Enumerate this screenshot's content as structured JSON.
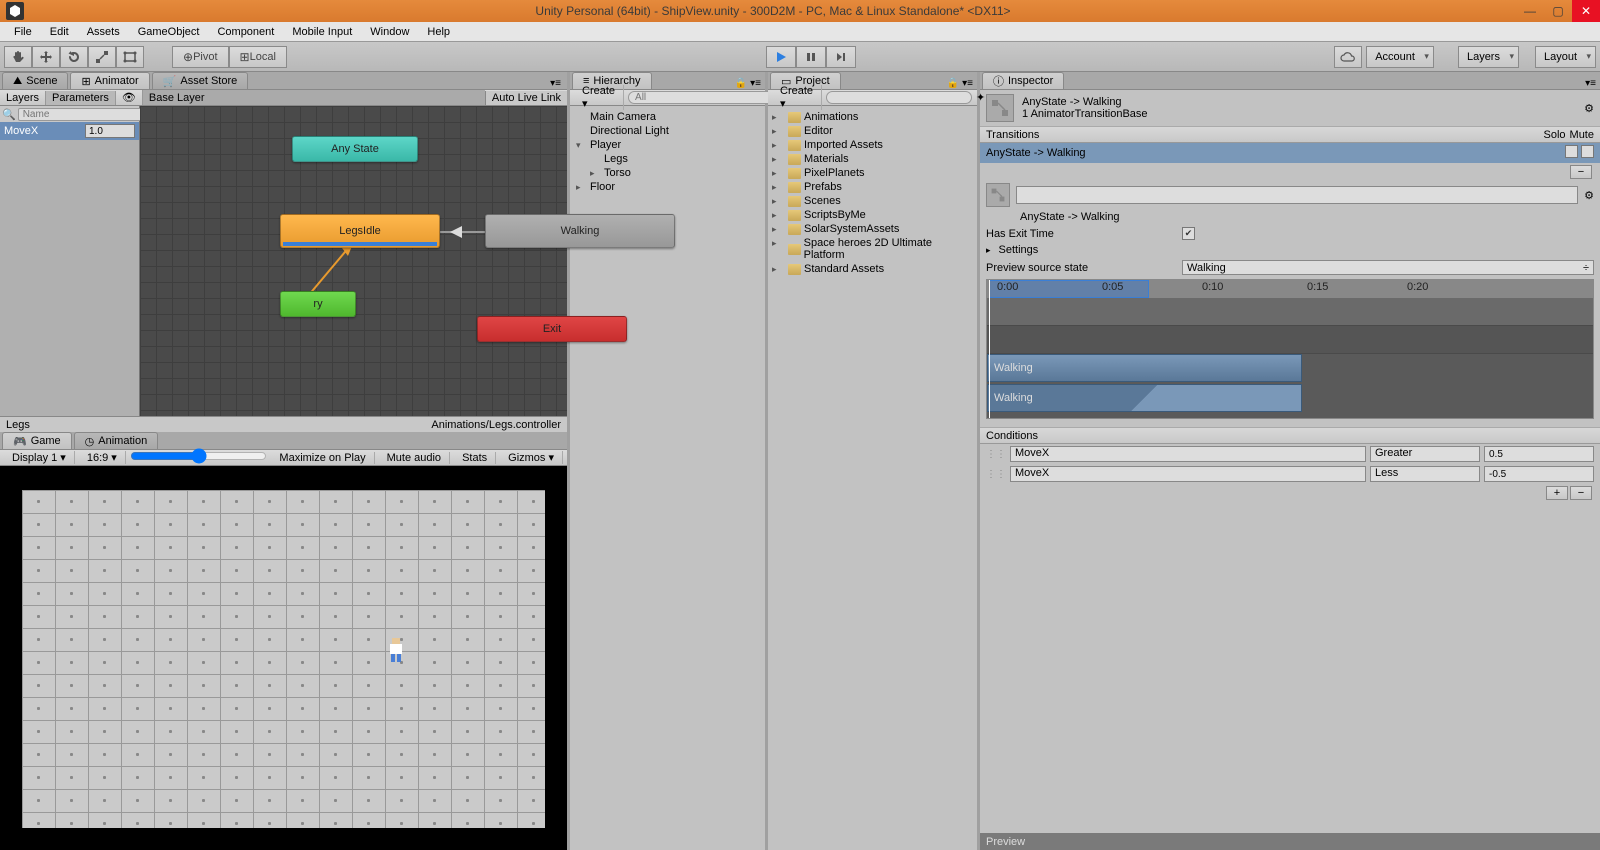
{
  "window": {
    "title": "Unity Personal (64bit) - ShipView.unity - 300D2M - PC, Mac & Linux Standalone* <DX11>"
  },
  "menubar": [
    "File",
    "Edit",
    "Assets",
    "GameObject",
    "Component",
    "Mobile Input",
    "Window",
    "Help"
  ],
  "toolbar": {
    "pivot": "Pivot",
    "local": "Local",
    "account": "Account",
    "layers": "Layers",
    "layout": "Layout"
  },
  "tabs_left_top": {
    "scene": "Scene",
    "animator": "Animator",
    "asset_store": "Asset Store"
  },
  "tabs_left_bottom": {
    "game": "Game",
    "animation": "Animation"
  },
  "tabs_mid1": {
    "hierarchy": "Hierarchy"
  },
  "tabs_mid2": {
    "project": "Project"
  },
  "tabs_right": {
    "inspector": "Inspector"
  },
  "animator": {
    "layers": "Layers",
    "parameters": "Parameters",
    "base_layer": "Base Layer",
    "auto_live": "Auto Live Link",
    "param_name": "Name",
    "param_movex": "MoveX",
    "param_movex_val": "1.0",
    "nodes": {
      "any": "Any State",
      "idle": "LegsIdle",
      "walk": "Walking",
      "entry": "ry",
      "exit": "Exit"
    },
    "footer_left": "Legs",
    "footer_right": "Animations/Legs.controller"
  },
  "game": {
    "display": "Display 1",
    "aspect": "16:9",
    "maximize": "Maximize on Play",
    "mute": "Mute audio",
    "stats": "Stats",
    "gizmos": "Gizmos"
  },
  "hierarchy": {
    "create": "Create",
    "search_ph": "All",
    "items": [
      "Main Camera",
      "Directional Light",
      "Player",
      "Legs",
      "Torso",
      "Floor"
    ]
  },
  "project": {
    "create": "Create",
    "folders": [
      "Animations",
      "Editor",
      "Imported Assets",
      "Materials",
      "PixelPlanets",
      "Prefabs",
      "Scenes",
      "ScriptsByMe",
      "SolarSystemAssets",
      "Space heroes 2D Ultimate Platform",
      "Standard Assets"
    ]
  },
  "inspector": {
    "title": "AnyState -> Walking",
    "subtitle": "1 AnimatorTransitionBase",
    "transitions_hdr": "Transitions",
    "solo": "Solo",
    "mute": "Mute",
    "trans_item": "AnyState -> Walking",
    "trans_box": "AnyState -> Walking",
    "has_exit": "Has Exit Time",
    "settings": "Settings",
    "preview_src": "Preview source state",
    "preview_val": "Walking",
    "ticks": [
      "0:00",
      "0:05",
      "0:10",
      "0:15",
      "0:20"
    ],
    "clip1": "Walking",
    "clip2": "Walking",
    "conditions": "Conditions",
    "cond": [
      {
        "param": "MoveX",
        "op": "Greater",
        "val": "0.5"
      },
      {
        "param": "MoveX",
        "op": "Less",
        "val": "-0.5"
      }
    ],
    "preview": "Preview"
  }
}
